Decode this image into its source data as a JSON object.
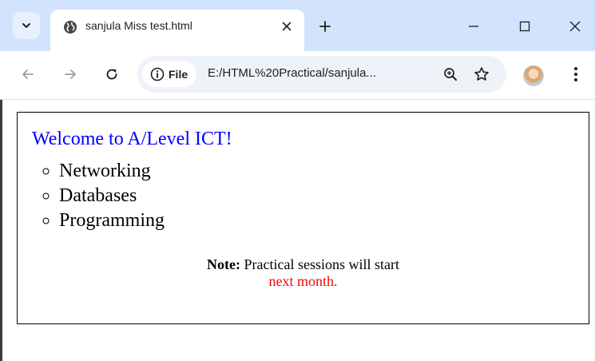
{
  "browser": {
    "tab": {
      "title": "sanjula Miss test.html",
      "favicon": "globe-icon"
    },
    "new_tab_icon": "plus-icon",
    "window_controls": [
      "minimize-icon",
      "maximize-icon",
      "close-icon"
    ],
    "omnibox": {
      "chip_label": "File",
      "url": "E:/HTML%20Practical/sanjula..."
    }
  },
  "page": {
    "heading": "Welcome to A/Level ICT!",
    "topics": [
      "Networking",
      "Databases",
      "Programming"
    ],
    "note": {
      "label": "Note:",
      "text": "Practical sessions will start",
      "highlight": "next month."
    }
  },
  "colors": {
    "tabstrip": "#d3e3fd",
    "heading": "#0000ff",
    "highlight": "#ff0000",
    "omnibox": "#eef2f9"
  }
}
